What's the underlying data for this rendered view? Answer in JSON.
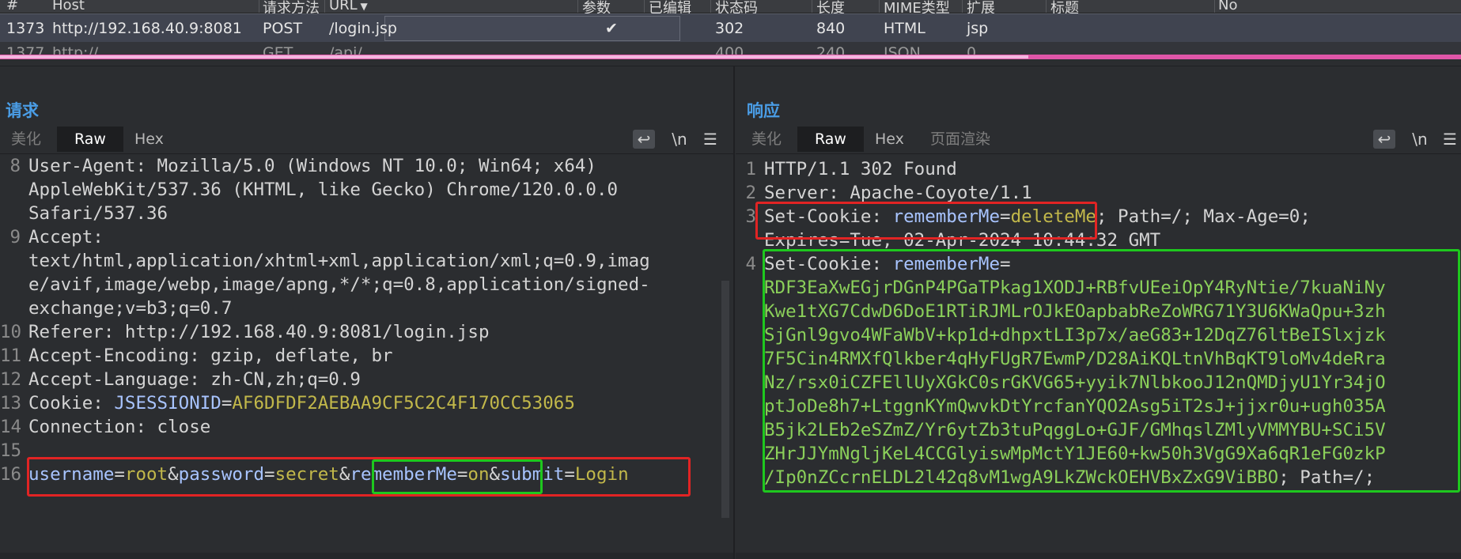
{
  "table": {
    "headers": [
      "#",
      "Host",
      "请求方法",
      "URL",
      "参数",
      "已编辑",
      "状态码",
      "长度",
      "MIME类型",
      "扩展",
      "标题",
      "No"
    ],
    "selected_row": {
      "num": "1373",
      "host": "http://192.168.40.9:8081",
      "method": "POST",
      "url": "/login.jsp",
      "params": "✔",
      "status": "302",
      "length": "840",
      "mime": "HTML",
      "ext": "jsp"
    },
    "partial_row": {
      "num": "1377",
      "host": "http://...",
      "method": "GET",
      "url": "/api/...",
      "status": "400",
      "length": "240",
      "mime": "JSON",
      "ext": "0"
    }
  },
  "request": {
    "title": "请求",
    "tabs": [
      "美化",
      "Raw",
      "Hex"
    ],
    "active_tab": "Raw",
    "icons": {
      "wrap": "↩",
      "newline": "\\n",
      "menu": "☰"
    },
    "lines": [
      {
        "num": "8",
        "key": "User-Agent",
        "val": " Mozilla/5.0 (Windows NT 10.0; Win64; x64)"
      },
      {
        "num": "",
        "key": "",
        "val": "AppleWebKit/537.36 (KHTML, like Gecko) Chrome/120.0.0.0"
      },
      {
        "num": "",
        "key": "",
        "val": "Safari/537.36"
      },
      {
        "num": "9",
        "key": "Accept",
        "val": ":"
      },
      {
        "num": "",
        "key": "",
        "val": "text/html,application/xhtml+xml,application/xml;q=0.9,imag"
      },
      {
        "num": "",
        "key": "",
        "val": "e/avif,image/webp,image/apng,*/*;q=0.8,application/signed-"
      },
      {
        "num": "",
        "key": "",
        "val": "exchange;v=b3;q=0.7"
      },
      {
        "num": "10",
        "key": "Referer",
        "val": " http://192.168.40.9:8081/login.jsp"
      },
      {
        "num": "11",
        "key": "Accept-Encoding",
        "val": " gzip, deflate, br"
      },
      {
        "num": "12",
        "key": "Accept-Language",
        "val": " zh-CN,zh;q=0.9"
      },
      {
        "num": "13",
        "key": "Cookie",
        "val": "JSESSIONID=AF6DFDF2AEBAA9CF5C2C4F170CC53065"
      },
      {
        "num": "14",
        "key": "Connection",
        "val": " close"
      },
      {
        "num": "15",
        "key": "",
        "val": ""
      },
      {
        "num": "16",
        "key": "",
        "val": "username=root&password=secret&rememberMe=on&submit=Login"
      }
    ],
    "body_parts": {
      "p1k": "username",
      "p1v": "root",
      "p2k": "password",
      "p2v": "secret",
      "p3k": "rememberMe",
      "p3v": "on",
      "p4k": "submit",
      "p4v": "Login"
    },
    "cookie_name": "JSESSIONID",
    "cookie_value": "AF6DFDF2AEBAA9CF5C2C4F170CC53065"
  },
  "response": {
    "title": "响应",
    "tabs": [
      "美化",
      "Raw",
      "Hex",
      "页面渲染"
    ],
    "active_tab": "Raw",
    "icons": {
      "wrap": "↩",
      "newline": "\\n",
      "menu": "☰"
    },
    "line1": "HTTP/1.1 302 Found",
    "line2_key": "Server",
    "line2_val": " Apache-Coyote/1.1",
    "line3_key": "Set-Cookie",
    "line3_name": "rememberMe",
    "line3_value": "deleteMe",
    "line3_rest": " Path=/; Max-Age=0;",
    "line3_cont": "Expires=Tue, 02-Apr-2024 10:44:32 GMT",
    "line4_key": "Set-Cookie",
    "line4_name": "rememberMe",
    "cookie_lines": [
      "RDF3EaXwEGjrDGnP4PGaTPkag1XODJ+RBfvUEeiOpY4RyNtie/7kuaNiNy",
      "Kwe1tXG7CdwD6DoE1RTiRJMLrOJkEOapbabReZoWRG71Y3U6KWaQpu+3zh",
      "SjGnl9gvo4WFaWbV+kp1d+dhpxtLI3p7x/aeG83+12DqZ76ltBeISlxjzk",
      "7F5Cin4RMXfQlkber4qHyFUgR7EwmP/D28AiKQLtnVhBqKT9loMv4deRra",
      "Nz/rsx0iCZFEllUyXGkC0srGKVG65+yyik7NlbkooJ12nQMDjyU1Yr34jO",
      "ptJoDe8h7+LtggnKYmQwvkDtYrcfanYQO2Asg5iT2sJ+jjxr0u+ugh035A",
      "B5jk2LEb2eSZmZ/Yr6ytZb3tuPqggLo+GJF/GMhqslZMlyVMMYBU+SCi5V",
      "ZHrJJYmNgljKeL4CCGlyiswMpMctY1JE60+kw50h3VgG9Xa6qR1eFG0zkP",
      "/Ip0nZCcrnELDL2l42q8vM1wgA9LkZWckOEHVBxZxG9ViBBO"
    ],
    "cookie_tail": "; Path=/;",
    "layout_icons": [
      "▥",
      "☰",
      "▭"
    ]
  },
  "colors": {
    "accent": "#4a9de6",
    "highlight_red": "#e12424",
    "highlight_green": "#1ec81e",
    "value_yellow": "#c2b84a",
    "name_blue": "#a8c4ff",
    "cookie_green": "#8bd05a"
  }
}
